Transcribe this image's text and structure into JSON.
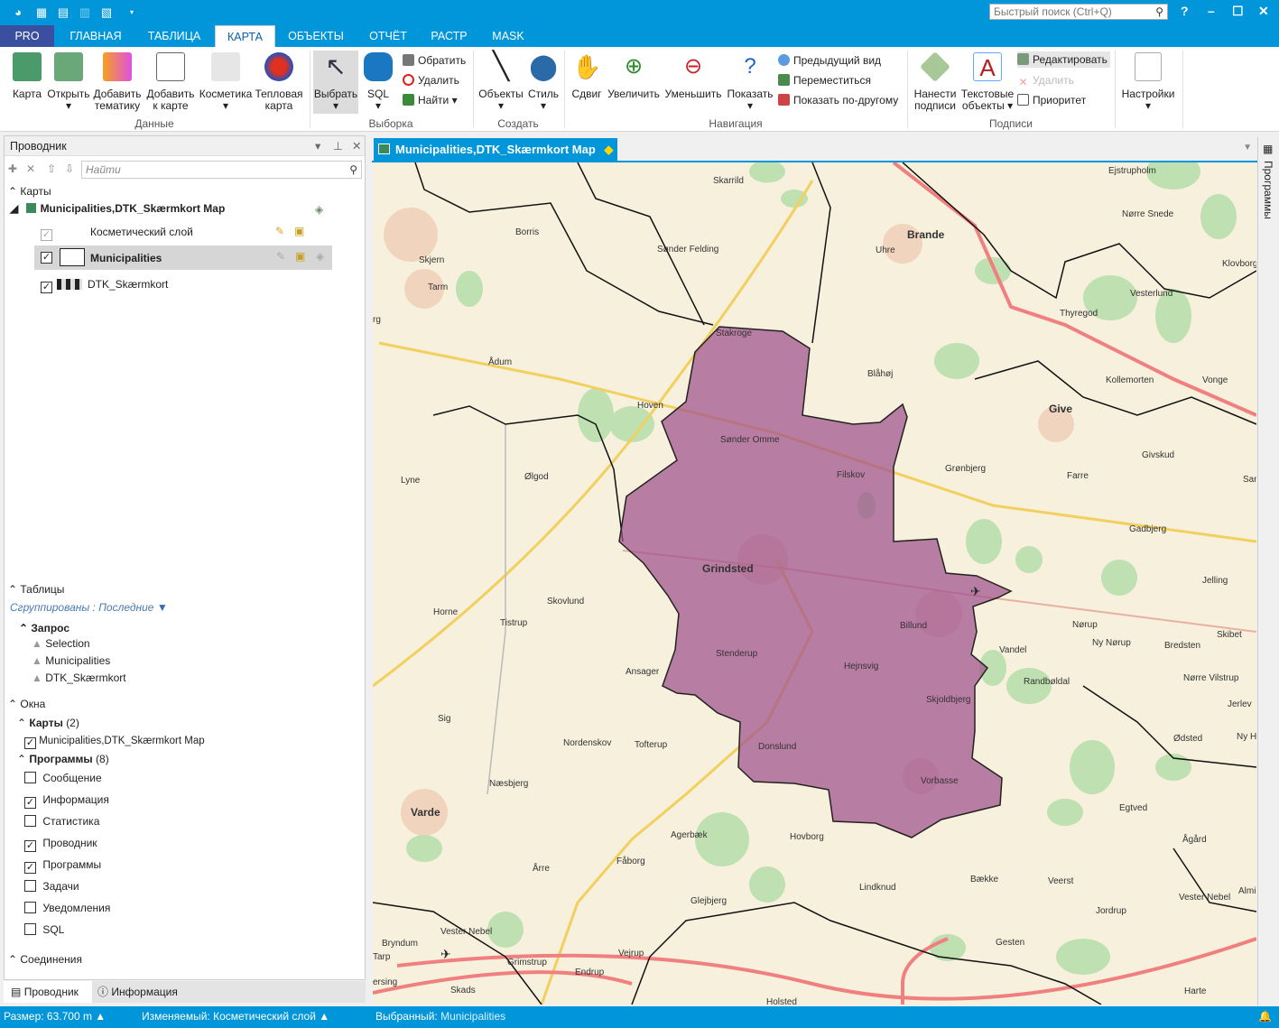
{
  "quick_access": {
    "icons": [
      "app-logo-icon",
      "new-table-icon",
      "open-icon",
      "save-icon",
      "close-icon",
      "dropdown-icon"
    ]
  },
  "search": {
    "placeholder": "Быстрый поиск (Ctrl+Q)"
  },
  "window": {
    "help": "?",
    "minimize": "–",
    "maximize": "☐",
    "close": "✕"
  },
  "tabs": [
    {
      "label": "PRO"
    },
    {
      "label": "ГЛАВНАЯ"
    },
    {
      "label": "ТАБЛИЦА"
    },
    {
      "label": "КАРТА",
      "active": true
    },
    {
      "label": "ОБЪЕКТЫ"
    },
    {
      "label": "ОТЧЁТ"
    },
    {
      "label": "РАСТР"
    },
    {
      "label": "MASK"
    }
  ],
  "ribbon": {
    "data": {
      "label": "Данные",
      "buttons": [
        {
          "label": "Карта"
        },
        {
          "label": "Открыть"
        },
        {
          "label": "Добавить тематику"
        },
        {
          "label": "Добавить к карте"
        },
        {
          "label": "Косметика"
        },
        {
          "label": "Тепловая карта"
        }
      ]
    },
    "selection": {
      "label": "Выборка",
      "select": "Выбрать",
      "sql": "SQL",
      "invert": "Обратить",
      "delete": "Удалить",
      "find": "Найти"
    },
    "create": {
      "label": "Создать",
      "objects": "Объекты",
      "style": "Стиль"
    },
    "navigation": {
      "label": "Навигация",
      "pan": "Сдвиг",
      "zoom_in": "Увеличить",
      "zoom_out": "Уменьшить",
      "show": "Показать",
      "prev_view": "Предыдущий вид",
      "move": "Переместиться",
      "show_other": "Показать по-другому"
    },
    "labels": {
      "label": "Подписи",
      "apply": "Нанести подписи",
      "text_objects": "Текстовые объекты",
      "edit": "Редактировать",
      "delete": "Удалить",
      "priority": "Приоритет"
    },
    "settings": {
      "label": "Настройки"
    }
  },
  "explorer": {
    "title": "Проводник",
    "find_placeholder": "Найти",
    "maps_header": "Карты",
    "map_name": "Municipalities,DTK_Skærmkort Map",
    "layers": [
      {
        "name": "Косметический слой",
        "checked": true,
        "disabled": true
      },
      {
        "name": "Municipalities",
        "checked": true,
        "selected": true
      },
      {
        "name": "DTK_Skærmkort",
        "checked": true
      }
    ],
    "tables_header": "Таблицы",
    "grouped": "Сгруппированы : Последние",
    "query_header": "Запрос",
    "tables": [
      "Selection",
      "Municipalities",
      "DTK_Skærmkort"
    ],
    "windows_header": "Окна",
    "maps_group": "Карты",
    "maps_count": "(2)",
    "map_window": "Municipalities,DTK_Skærmkort Map",
    "programs_group": "Программы",
    "programs_count": "(8)",
    "programs": [
      {
        "name": "Сообщение",
        "checked": false
      },
      {
        "name": "Информация",
        "checked": true
      },
      {
        "name": "Статистика",
        "checked": false
      },
      {
        "name": "Проводник",
        "checked": true
      },
      {
        "name": "Программы",
        "checked": true
      },
      {
        "name": "Задачи",
        "checked": false
      },
      {
        "name": "Уведомления",
        "checked": false
      },
      {
        "name": "SQL",
        "checked": false
      }
    ],
    "connections_header": "Соединения"
  },
  "bottom_tabs": [
    {
      "label": "Проводник",
      "active": true
    },
    {
      "label": "Информация"
    }
  ],
  "document": {
    "tab_title": "Municipalities,DTK_Skærmkort Map"
  },
  "right_strip": {
    "label": "Программы"
  },
  "map": {
    "highlight_color": "#a0508c",
    "places": [
      "Skarrild",
      "Ejstrupholm",
      "Borris",
      "Sønder Felding",
      "Uhre",
      "Brande",
      "Nørre Snede",
      "Skjern",
      "Tarm",
      "Klovborg",
      "Vesterlund",
      "Thyregod",
      "Stakroge",
      "Ådum",
      "Blåhøj",
      "Kollemorten",
      "Vonge",
      "Hoven",
      "Give",
      "Sønder Omme",
      "Lyne",
      "Ølgod",
      "Filskov",
      "Grønbjerg",
      "Farre",
      "Givskud",
      "Gadbjerg",
      "Grindsted",
      "Jelling",
      "Skovlund",
      "Horne",
      "Tistrup",
      "Billund",
      "Nørup",
      "Ny Nørup",
      "Bredsten",
      "Skibet",
      "Vandel",
      "Stenderup",
      "Hejnsvig",
      "Ansager",
      "Randbøldal",
      "Nørre Vilstrup",
      "Skjoldbjerg",
      "Jerlev",
      "Sig",
      "Nordenskov",
      "Tofterup",
      "Donslund",
      "Ødsted",
      "Næsbjerg",
      "Vorbasse",
      "Varde",
      "Egtved",
      "Agerbæk",
      "Hovborg",
      "Ågård",
      "Fåborg",
      "Årre",
      "Bække",
      "Veerst",
      "Lindknud",
      "Almi",
      "Glejbjerg",
      "Vester Nebel",
      "Jordrup",
      "Vester Nebel",
      "Bryndum",
      "Tarp",
      "Gesten",
      "Vejrup",
      "Grimstrup",
      "Endrup",
      "ersing",
      "Skads",
      "Harte",
      "Holsted",
      "San",
      "Ny H",
      "rg"
    ]
  },
  "status": {
    "size": "Размер: 63.700 m",
    "editable": "Изменяемый: Косметический слой",
    "selected_label": "Выбранный: ",
    "selected_value": "Municipalities"
  }
}
